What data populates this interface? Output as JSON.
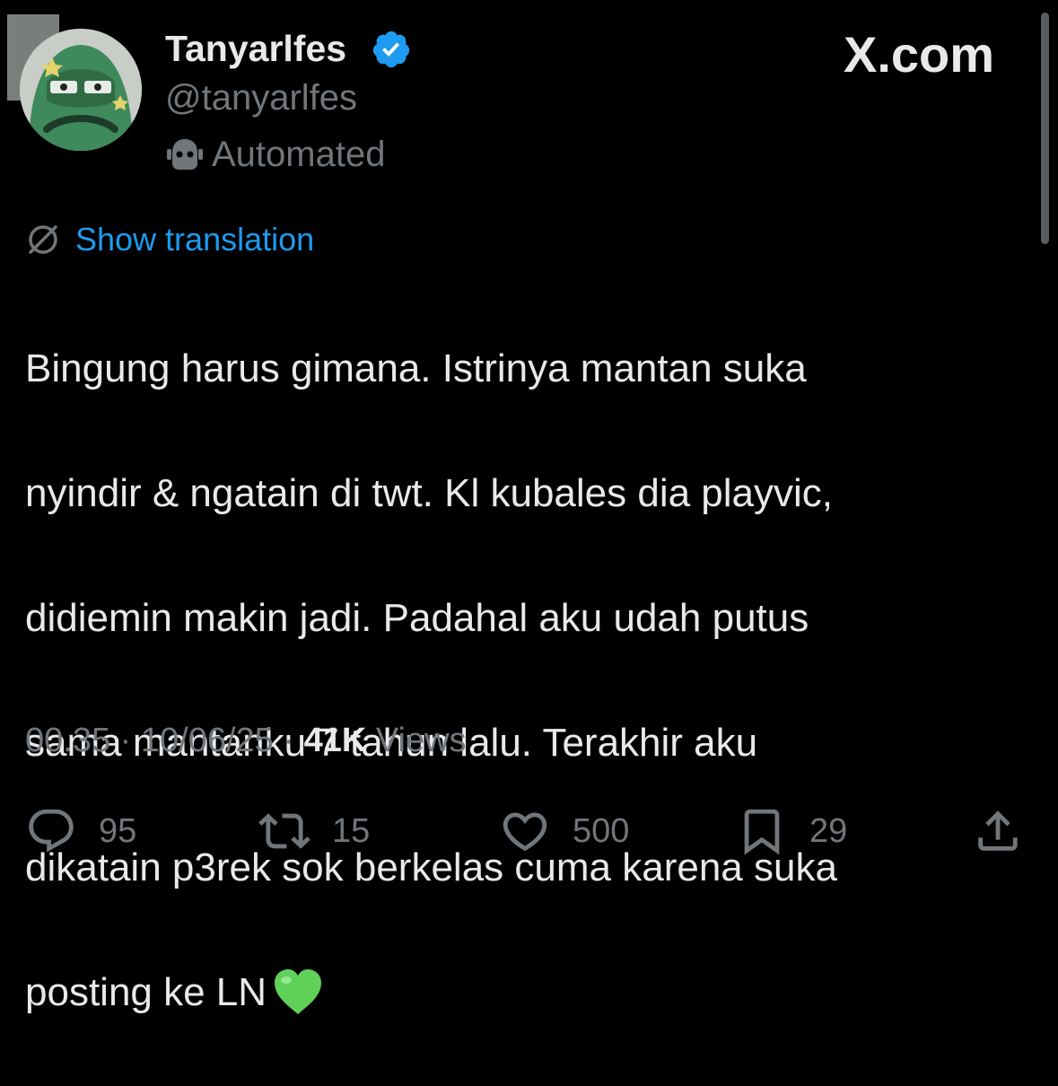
{
  "author": {
    "display_name": "Tanyarlfes",
    "handle": "@tanyarlfes",
    "badge_label": "Automated",
    "verified_color": "#1d9bf0"
  },
  "brand": {
    "logo_text": "X.com"
  },
  "translate": {
    "label": "Show translation",
    "icon": "translate-icon"
  },
  "tweet": {
    "lines": [
      "Bingung harus gimana. Istrinya mantan suka",
      "nyindir & ngatain di twt. Kl kubales dia playvic,",
      "didiemin makin jadi. Padahal aku udah putus",
      "sama mantanku 7 tahun lalu. Terakhir aku",
      "dikatain p3rek sok berkelas cuma karena suka",
      "posting ke LN"
    ],
    "emoji": "green-heart-icon"
  },
  "meta": {
    "time": "00.35",
    "date": "10/06/25",
    "views_count": "41K",
    "views_label": "Views",
    "separator": "·"
  },
  "actions": {
    "replies": "95",
    "reposts": "15",
    "likes": "500",
    "bookmarks": "29"
  },
  "colors": {
    "background": "#000000",
    "text": "#e7e9ea",
    "muted": "#71767b",
    "accent": "#1d9bf0",
    "heart_emoji": "#5fd158"
  }
}
